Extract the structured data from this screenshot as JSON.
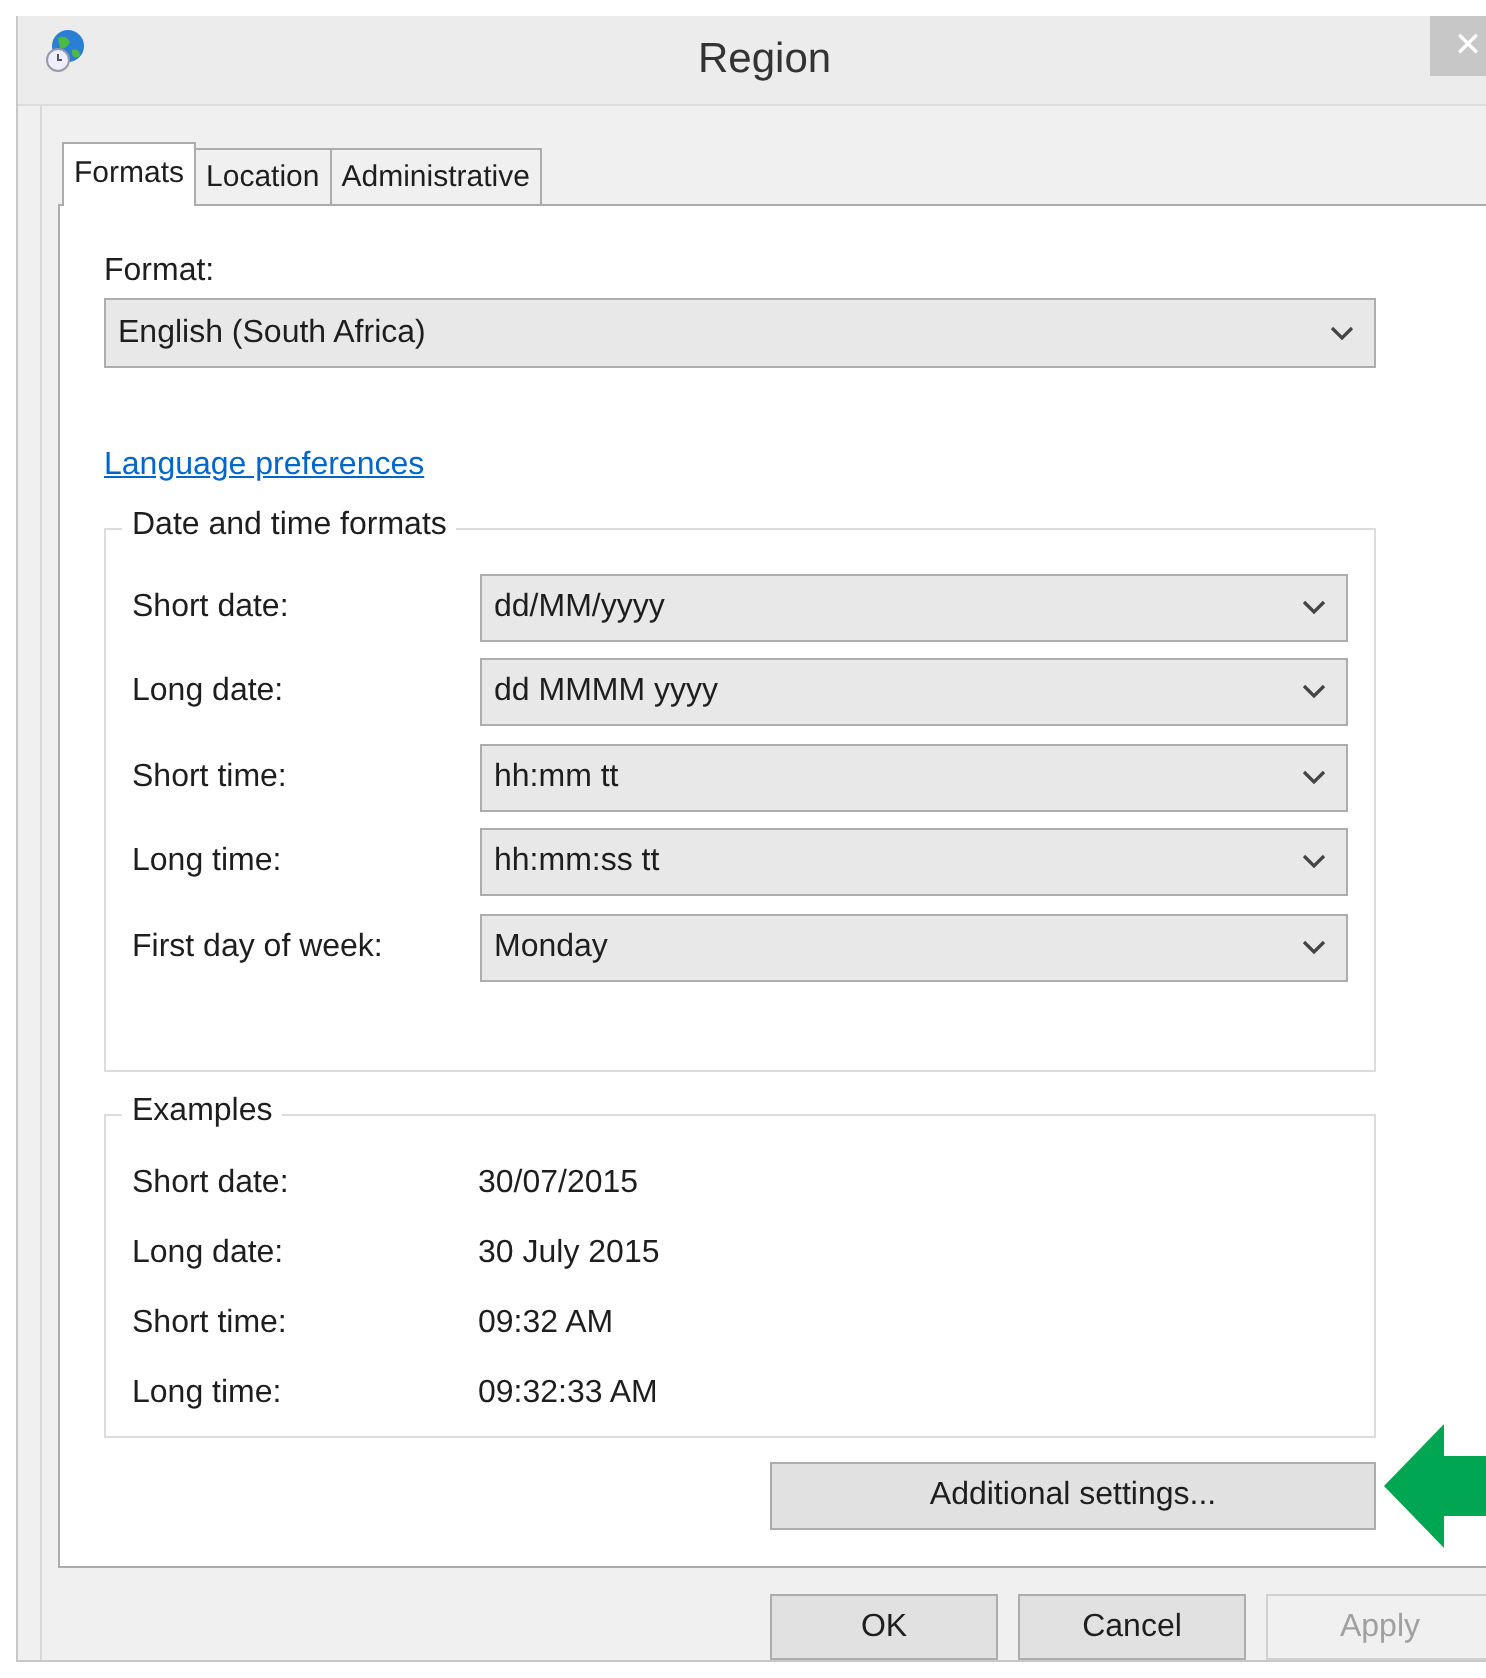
{
  "window": {
    "title": "Region",
    "close": "✕"
  },
  "tabs": [
    {
      "label": "Formats",
      "selected": true
    },
    {
      "label": "Location",
      "selected": false
    },
    {
      "label": "Administrative",
      "selected": false
    }
  ],
  "format": {
    "label": "Format:",
    "value": "English (South Africa)"
  },
  "link": "Language preferences",
  "date_time_formats": {
    "title": "Date and time formats",
    "rows": [
      {
        "label": "Short date:",
        "value": "dd/MM/yyyy"
      },
      {
        "label": "Long date:",
        "value": "dd MMMM yyyy"
      },
      {
        "label": "Short time:",
        "value": "hh:mm tt"
      },
      {
        "label": "Long time:",
        "value": "hh:mm:ss tt"
      },
      {
        "label": "First day of week:",
        "value": "Monday"
      }
    ]
  },
  "examples": {
    "title": "Examples",
    "rows": [
      {
        "label": "Short date:",
        "value": "30/07/2015"
      },
      {
        "label": "Long date:",
        "value": "30 July 2015"
      },
      {
        "label": "Short time:",
        "value": "09:32 AM"
      },
      {
        "label": "Long time:",
        "value": "09:32:33 AM"
      }
    ]
  },
  "additional_button": "Additional settings...",
  "buttons": [
    {
      "label": "OK",
      "disabled": false
    },
    {
      "label": "Cancel",
      "disabled": false
    },
    {
      "label": "Apply",
      "disabled": true
    }
  ]
}
